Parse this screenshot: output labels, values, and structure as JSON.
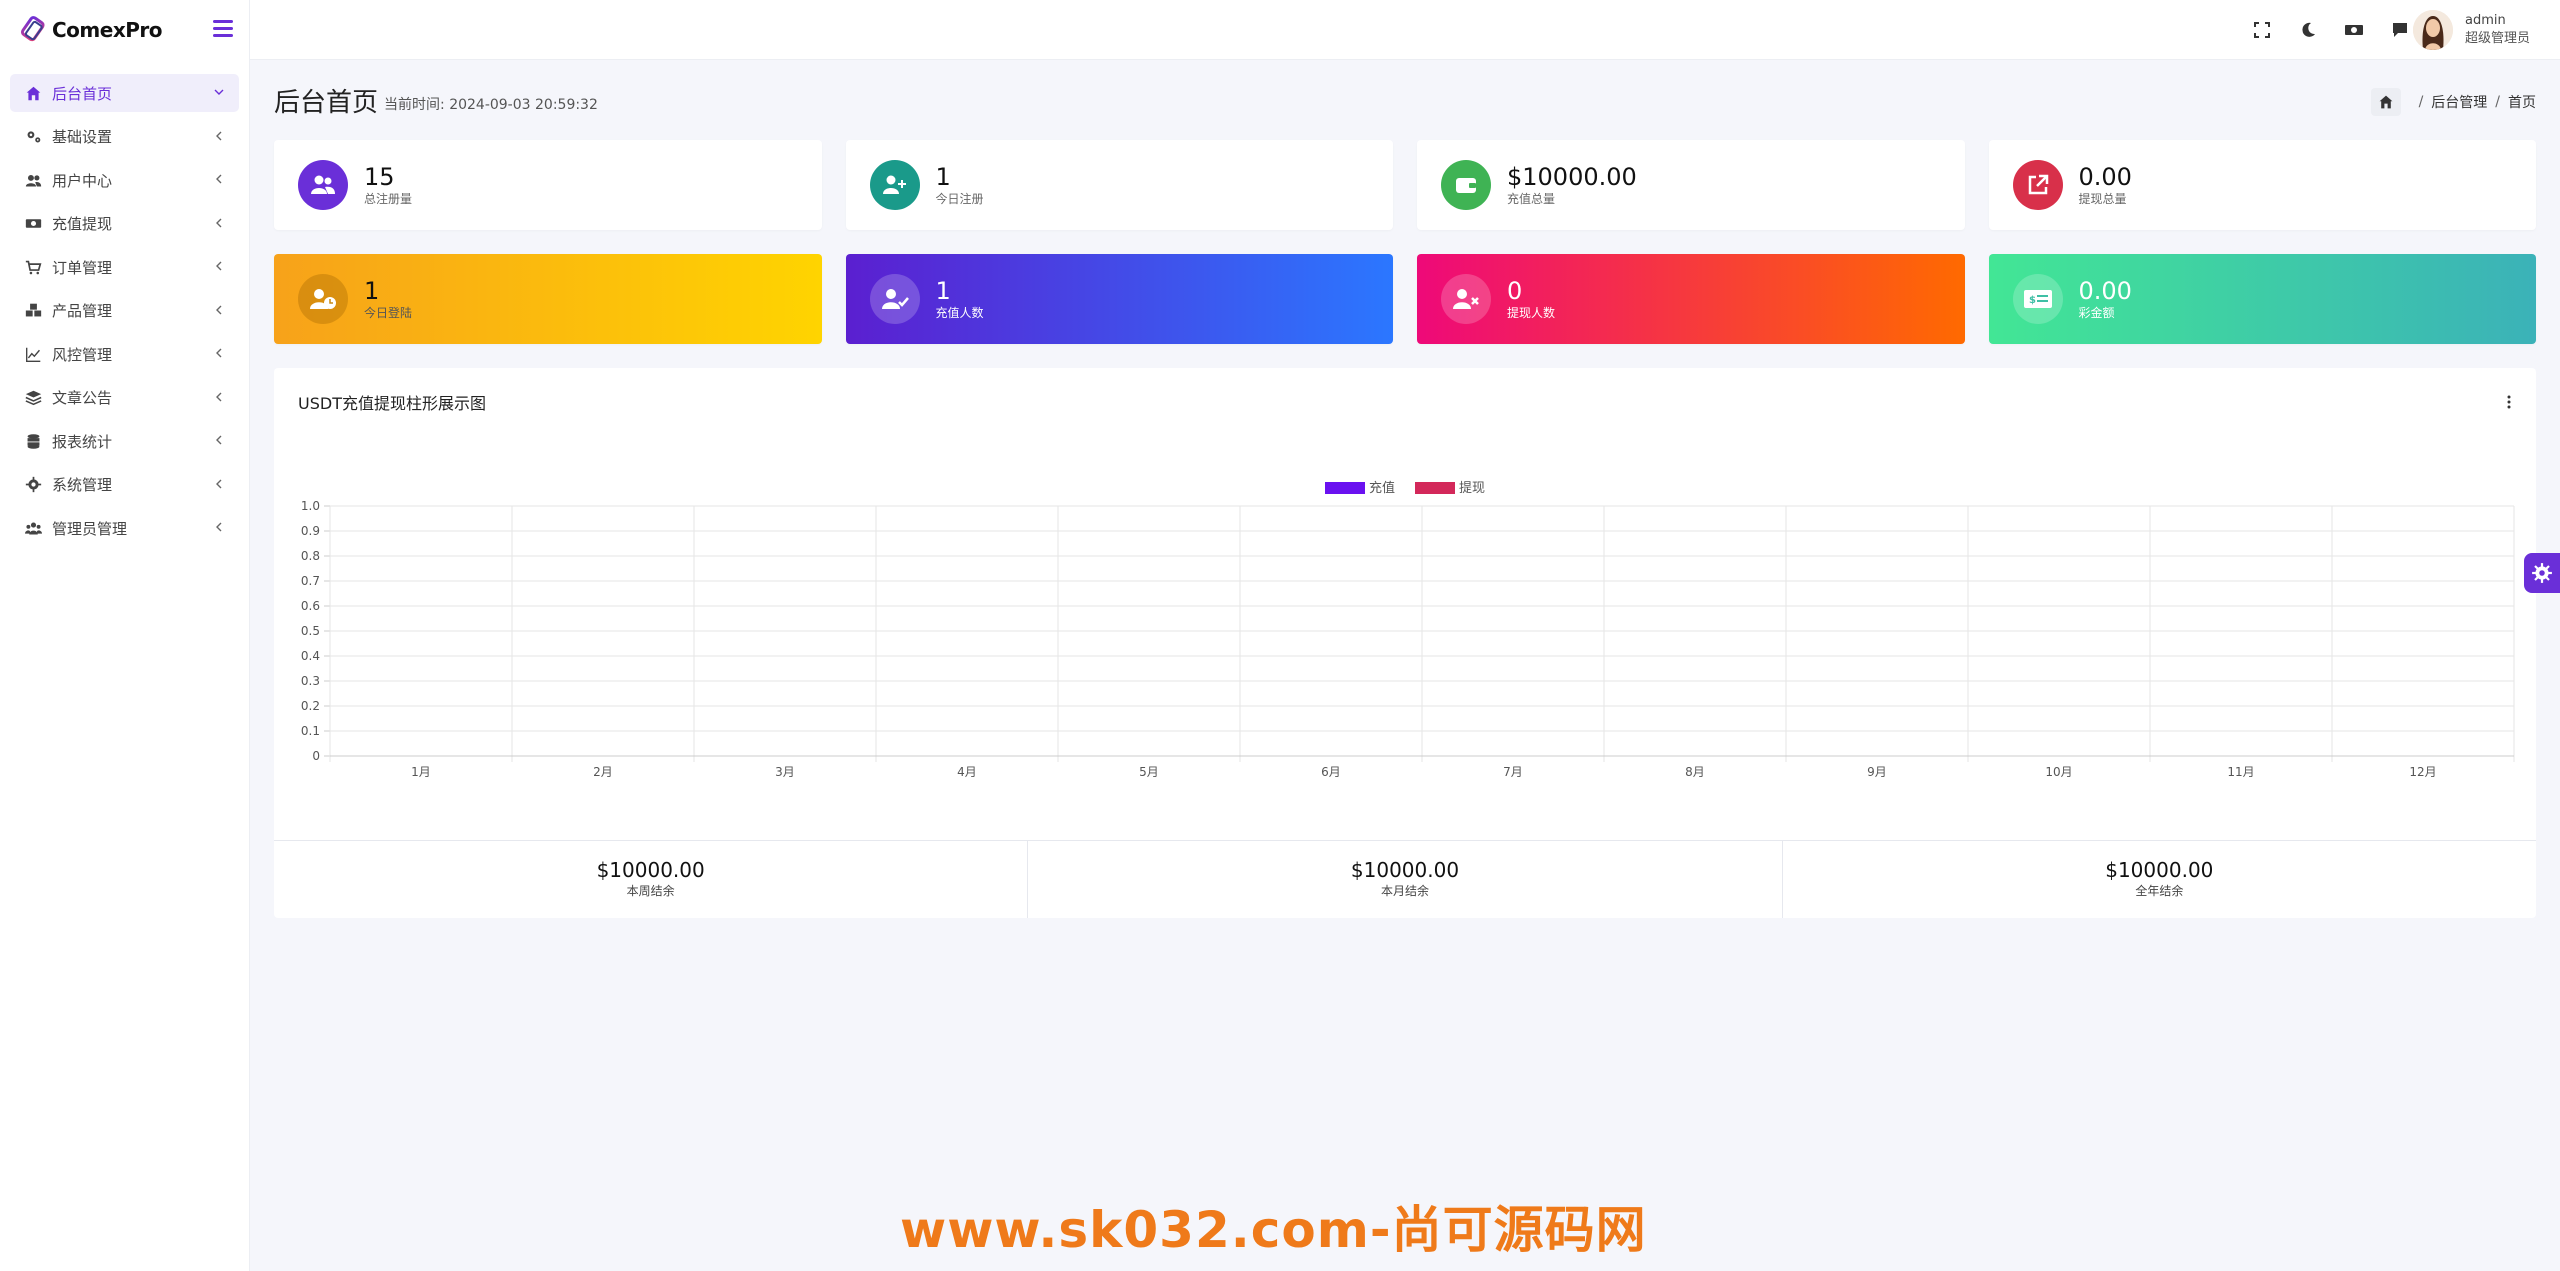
{
  "app": {
    "brand": "ComexPro"
  },
  "sidebar": {
    "items": [
      {
        "label": "后台首页",
        "icon": "home-icon",
        "active": true
      },
      {
        "label": "基础设置",
        "icon": "gears-icon"
      },
      {
        "label": "用户中心",
        "icon": "users-icon"
      },
      {
        "label": "充值提现",
        "icon": "money-icon"
      },
      {
        "label": "订单管理",
        "icon": "cart-icon"
      },
      {
        "label": "产品管理",
        "icon": "cubes-icon"
      },
      {
        "label": "风控管理",
        "icon": "chart-line-icon"
      },
      {
        "label": "文章公告",
        "icon": "layers-icon"
      },
      {
        "label": "报表统计",
        "icon": "database-icon"
      },
      {
        "label": "系统管理",
        "icon": "gear-icon"
      },
      {
        "label": "管理员管理",
        "icon": "user-group-icon"
      }
    ]
  },
  "topbar": {
    "icons": [
      "fullscreen-icon",
      "moon-icon",
      "cash-icon",
      "message-icon"
    ],
    "user": {
      "name": "admin",
      "role": "超级管理员"
    }
  },
  "page": {
    "title": "后台首页",
    "time_label": "当前时间:",
    "time_value": "2024-09-03 20:59:32",
    "breadcrumb": [
      "后台管理",
      "首页"
    ]
  },
  "stats_row1": [
    {
      "value": "15",
      "label": "总注册量",
      "icon": "users-icon",
      "color": "#6a2fd8"
    },
    {
      "value": "1",
      "label": "今日注册",
      "icon": "user-plus-icon",
      "color": "#1a9a8a"
    },
    {
      "value": "$10000.00",
      "label": "充值总量",
      "icon": "wallet-icon",
      "color": "#3fb354"
    },
    {
      "value": "0.00",
      "label": "提现总量",
      "icon": "external-link-icon",
      "color": "#d8304a"
    }
  ],
  "stats_row2": [
    {
      "value": "1",
      "label": "今日登陆",
      "icon": "user-clock-icon"
    },
    {
      "value": "1",
      "label": "充值人数",
      "icon": "user-check-icon"
    },
    {
      "value": "0",
      "label": "提现人数",
      "icon": "user-times-icon"
    },
    {
      "value": "0.00",
      "label": "彩金额",
      "icon": "money-bill-icon"
    }
  ],
  "chart_data": {
    "type": "bar",
    "title": "USDT充值提现柱形展示图",
    "categories": [
      "1月",
      "2月",
      "3月",
      "4月",
      "5月",
      "6月",
      "7月",
      "8月",
      "9月",
      "10月",
      "11月",
      "12月"
    ],
    "series": [
      {
        "name": "充值",
        "color": "#6a11f0",
        "values": [
          0,
          0,
          0,
          0,
          0,
          0,
          0,
          0,
          0,
          0,
          0,
          0
        ]
      },
      {
        "name": "提现",
        "color": "#d3285a",
        "values": [
          0,
          0,
          0,
          0,
          0,
          0,
          0,
          0,
          0,
          0,
          0,
          0
        ]
      }
    ],
    "ylim": [
      0,
      1.0
    ],
    "yticks": [
      "0",
      "0.1",
      "0.2",
      "0.3",
      "0.4",
      "0.5",
      "0.6",
      "0.7",
      "0.8",
      "0.9",
      "1.0"
    ],
    "legend": "top-center",
    "grid": true
  },
  "summary": [
    {
      "value": "$10000.00",
      "label": "本周结余"
    },
    {
      "value": "$10000.00",
      "label": "本月结余"
    },
    {
      "value": "$10000.00",
      "label": "全年结余"
    }
  ],
  "watermark": "www.sk032.com-尚可源码网"
}
